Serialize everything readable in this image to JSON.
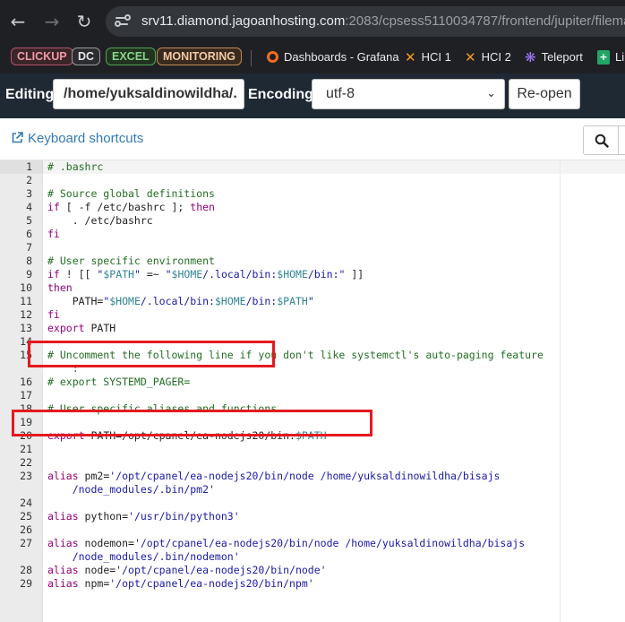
{
  "browser": {
    "url_host": "srv11.diamond.jagoanhosting.com",
    "url_rest": ":2083/cpsess5110034787/frontend/jupiter/filemanager",
    "bookmarks_pills": [
      {
        "label": "CLICKUP"
      },
      {
        "label": "DC"
      },
      {
        "label": "EXCEL"
      },
      {
        "label": "MONITORING"
      }
    ],
    "bookmarks": [
      {
        "label": "Dashboards - Grafana",
        "icon": "grafana-icon"
      },
      {
        "label": "HCI 1",
        "icon": "x-logo-icon"
      },
      {
        "label": "HCI 2",
        "icon": "x-logo-icon"
      },
      {
        "label": "Teleport",
        "icon": "teleport-icon"
      },
      {
        "label": "Li",
        "icon": "spreadsheet-icon"
      }
    ]
  },
  "toolbar": {
    "editing_label": "Editing:",
    "path_value": "/home/yuksaldinowildha/.",
    "encoding_label": "Encoding:",
    "encoding_value": "utf-8",
    "reopen_label": "Re-open"
  },
  "editor_header": {
    "keyboard_shortcuts": "Keyboard shortcuts"
  },
  "code": {
    "lines": [
      {
        "n": "1",
        "tokens": [
          {
            "t": "# .bashrc",
            "c": "comment"
          }
        ]
      },
      {
        "n": "2",
        "tokens": []
      },
      {
        "n": "3",
        "tokens": [
          {
            "t": "# Source global definitions",
            "c": "comment"
          }
        ]
      },
      {
        "n": "4",
        "tokens": [
          {
            "t": "if",
            "c": "kw"
          },
          {
            "t": " [ -f /etc/bashrc ]; ",
            "c": "plain"
          },
          {
            "t": "then",
            "c": "kw"
          }
        ]
      },
      {
        "n": "5",
        "tokens": [
          {
            "t": "    . /etc/bashrc",
            "c": "plain"
          }
        ]
      },
      {
        "n": "6",
        "tokens": [
          {
            "t": "fi",
            "c": "kw"
          }
        ]
      },
      {
        "n": "7",
        "tokens": []
      },
      {
        "n": "8",
        "tokens": [
          {
            "t": "# User specific environment",
            "c": "comment"
          }
        ]
      },
      {
        "n": "9",
        "tokens": [
          {
            "t": "if",
            "c": "kw"
          },
          {
            "t": " ! [[ ",
            "c": "plain"
          },
          {
            "t": "\"",
            "c": "str"
          },
          {
            "t": "$PATH",
            "c": "var"
          },
          {
            "t": "\"",
            "c": "str"
          },
          {
            "t": " =~ ",
            "c": "plain"
          },
          {
            "t": "\"",
            "c": "str"
          },
          {
            "t": "$HOME",
            "c": "var"
          },
          {
            "t": "/.local/bin:",
            "c": "str"
          },
          {
            "t": "$HOME",
            "c": "var"
          },
          {
            "t": "/bin:\"",
            "c": "str"
          },
          {
            "t": " ]]",
            "c": "plain"
          }
        ]
      },
      {
        "n": "10",
        "tokens": [
          {
            "t": "then",
            "c": "kw"
          }
        ]
      },
      {
        "n": "11",
        "tokens": [
          {
            "t": "    PATH=",
            "c": "plain"
          },
          {
            "t": "\"",
            "c": "str"
          },
          {
            "t": "$HOME",
            "c": "var"
          },
          {
            "t": "/.local/bin:",
            "c": "str"
          },
          {
            "t": "$HOME",
            "c": "var"
          },
          {
            "t": "/bin:",
            "c": "str"
          },
          {
            "t": "$PATH",
            "c": "var"
          },
          {
            "t": "\"",
            "c": "str"
          }
        ]
      },
      {
        "n": "12",
        "tokens": [
          {
            "t": "fi",
            "c": "kw"
          }
        ]
      },
      {
        "n": "13",
        "tokens": [
          {
            "t": "export",
            "c": "kw"
          },
          {
            "t": " PATH",
            "c": "plain"
          }
        ]
      },
      {
        "n": "14",
        "tokens": []
      },
      {
        "n": "15",
        "tokens": [
          {
            "t": "# Uncomment the following line if you don't like systemctl's auto-paging feature",
            "c": "comment"
          }
        ]
      },
      {
        "n": "",
        "tokens": [
          {
            "t": "    :",
            "c": "comment"
          }
        ]
      },
      {
        "n": "16",
        "tokens": [
          {
            "t": "# export SYSTEMD_PAGER=",
            "c": "comment"
          }
        ]
      },
      {
        "n": "17",
        "tokens": []
      },
      {
        "n": "18",
        "tokens": [
          {
            "t": "# User specific aliases and functions",
            "c": "comment"
          }
        ]
      },
      {
        "n": "19",
        "tokens": []
      },
      {
        "n": "20",
        "tokens": [
          {
            "t": "export",
            "c": "kw"
          },
          {
            "t": " PATH=/opt/cpanel/ea-nodejs20/bin:",
            "c": "plain"
          },
          {
            "t": "$PATH",
            "c": "var"
          }
        ]
      },
      {
        "n": "21",
        "tokens": []
      },
      {
        "n": "22",
        "tokens": []
      },
      {
        "n": "23",
        "tokens": [
          {
            "t": "alias",
            "c": "kw"
          },
          {
            "t": " pm2=",
            "c": "plain"
          },
          {
            "t": "'/opt/cpanel/ea-nodejs20/bin/node /home/yuksaldinowildha/bisajs",
            "c": "str"
          }
        ]
      },
      {
        "n": "",
        "tokens": [
          {
            "t": "    /node_modules/.bin/pm2'",
            "c": "str"
          }
        ]
      },
      {
        "n": "24",
        "tokens": []
      },
      {
        "n": "25",
        "tokens": [
          {
            "t": "alias",
            "c": "kw"
          },
          {
            "t": " python=",
            "c": "plain"
          },
          {
            "t": "'/usr/bin/python3'",
            "c": "str"
          }
        ]
      },
      {
        "n": "26",
        "tokens": []
      },
      {
        "n": "27",
        "tokens": [
          {
            "t": "alias",
            "c": "kw"
          },
          {
            "t": " nodemon=",
            "c": "plain"
          },
          {
            "t": "'/opt/cpanel/ea-nodejs20/bin/node /home/yuksaldinowildha/bisajs",
            "c": "str"
          }
        ]
      },
      {
        "n": "",
        "tokens": [
          {
            "t": "    /node_modules/.bin/nodemon'",
            "c": "str"
          }
        ]
      },
      {
        "n": "28",
        "tokens": [
          {
            "t": "alias",
            "c": "kw"
          },
          {
            "t": " node=",
            "c": "plain"
          },
          {
            "t": "'/opt/cpanel/ea-nodejs20/bin/node'",
            "c": "str"
          }
        ]
      },
      {
        "n": "29",
        "tokens": [
          {
            "t": "alias",
            "c": "kw"
          },
          {
            "t": " npm=",
            "c": "plain"
          },
          {
            "t": "'/opt/cpanel/ea-nodejs20/bin/npm'",
            "c": "str"
          }
        ]
      }
    ]
  },
  "colors": {
    "toolbar_bg": "#1f2933",
    "link": "#337ab7",
    "highlight_box": "#e4191f",
    "comment": "#236e24",
    "keyword": "#93007a",
    "string": "#1a1aa6",
    "variable": "#318495"
  }
}
